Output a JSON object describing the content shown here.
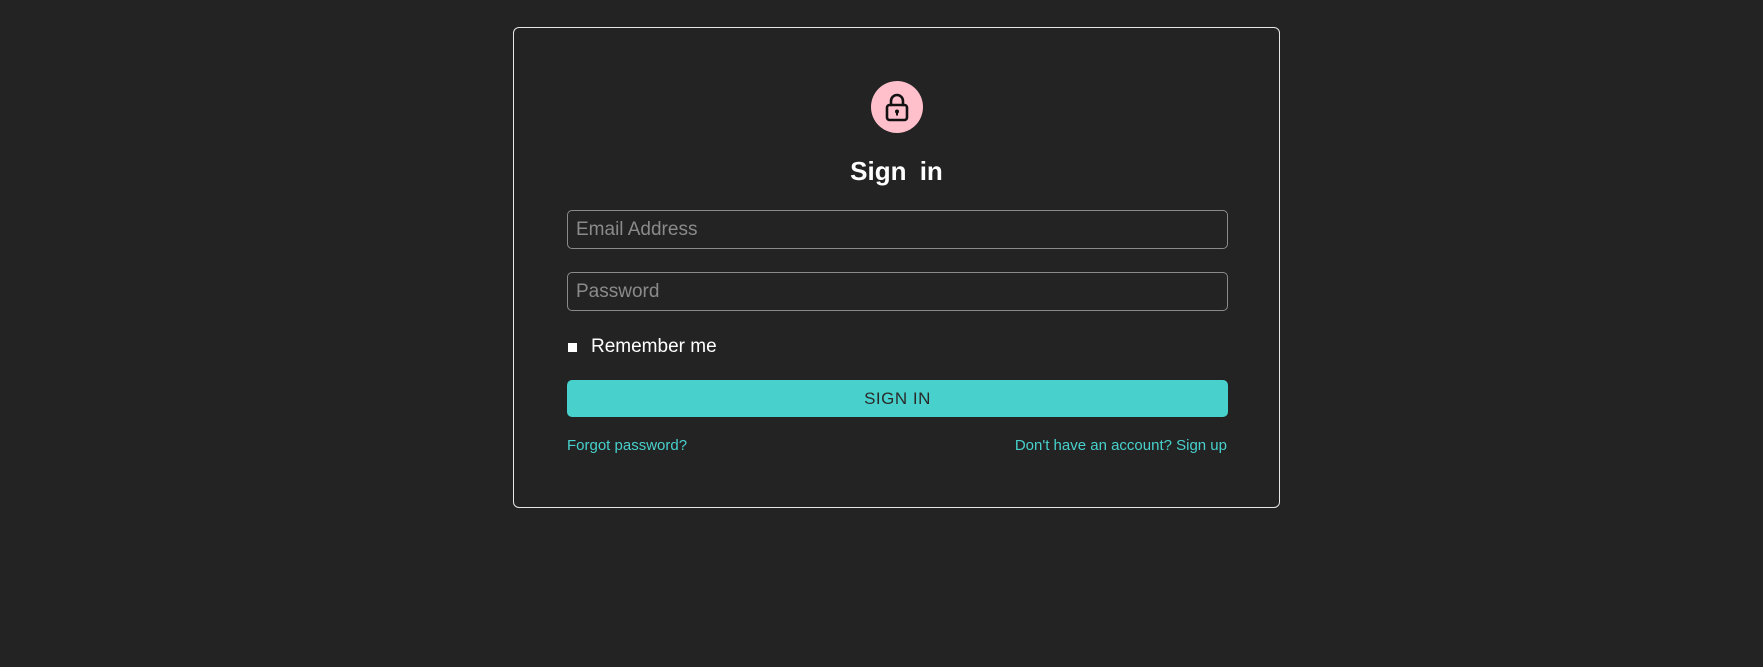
{
  "signin_form": {
    "icon": "lock-icon",
    "title": "Sign in",
    "email": {
      "value": "",
      "placeholder": "Email Address"
    },
    "password": {
      "value": "",
      "placeholder": "Password"
    },
    "remember_me": {
      "label": "Remember me",
      "checked": false
    },
    "submit_label": "SIGN IN",
    "forgot_password_link": "Forgot password?",
    "signup_link": "Don't have an account? Sign up"
  },
  "colors": {
    "background": "#232323",
    "card_border": "#e6e6e6",
    "avatar": "#ffc0cb",
    "accent": "#48d1cc",
    "text": "#ffffff",
    "placeholder": "#8a8a8a"
  }
}
